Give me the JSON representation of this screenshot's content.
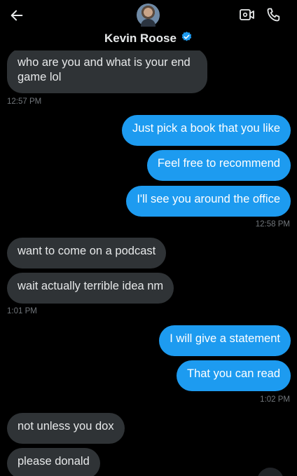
{
  "header": {
    "contact_name": "Kevin Roose",
    "back_icon": "arrow-left-icon",
    "verified_icon": "verified-badge-icon",
    "video_icon": "video-call-icon",
    "phone_icon": "phone-call-icon"
  },
  "colors": {
    "background": "#000000",
    "incoming_bubble": "#2f3336",
    "outgoing_bubble": "#1d9bf0",
    "timestamp": "#71767b",
    "verified": "#1d9bf0"
  },
  "messages": [
    {
      "dir": "in",
      "text_line1": "who are you and what is your end",
      "text_line2": "game lol"
    },
    {
      "time": "12:57 PM"
    },
    {
      "dir": "out",
      "text": "Just pick a book that you like"
    },
    {
      "dir": "out",
      "text": "Feel free to recommend"
    },
    {
      "dir": "out",
      "text": "I'll see you around the office"
    },
    {
      "time": "12:58 PM"
    },
    {
      "dir": "in",
      "text": "want to come on a podcast"
    },
    {
      "dir": "in",
      "text": "wait actually terrible idea nm"
    },
    {
      "time": "1:01 PM"
    },
    {
      "dir": "out",
      "text": "I will give a statement"
    },
    {
      "dir": "out",
      "text": "That you can read"
    },
    {
      "time": "1:02 PM"
    },
    {
      "dir": "in",
      "text": "not unless you dox"
    },
    {
      "dir": "in",
      "text": "please donald"
    }
  ]
}
